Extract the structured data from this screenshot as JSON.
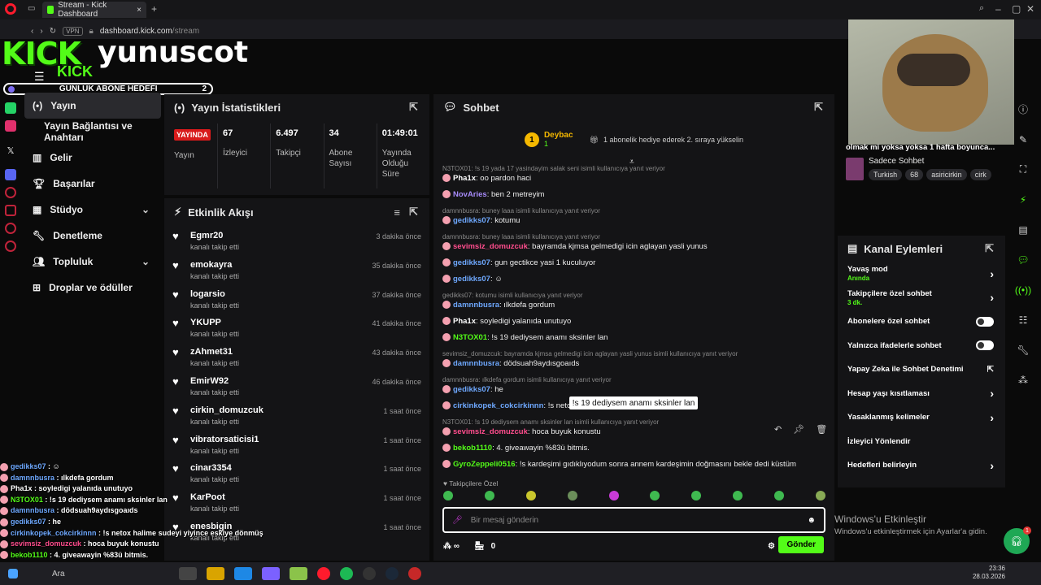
{
  "browser": {
    "tab_title": "Stream - Kick Dashboard",
    "vpn": "VPN",
    "url_host": "dashboard.kick.com",
    "url_path": "/stream"
  },
  "logo": {
    "kick": "KICK",
    "username": "yunuscot",
    "kick_small": "KICK"
  },
  "goal": {
    "label": "GUNLUK ABONE HEDEFI",
    "value": "2"
  },
  "nav": {
    "items": [
      {
        "label": "Yayın",
        "icon": "stream-icon"
      },
      {
        "label": "Yayın Bağlantısı ve Anahtarı",
        "icon": ""
      },
      {
        "label": "Gelir",
        "icon": "revenue-icon"
      },
      {
        "label": "Başarılar",
        "icon": "trophy-icon"
      },
      {
        "label": "Stüdyo",
        "icon": "studio-icon"
      },
      {
        "label": "Denetleme",
        "icon": "wrench-icon"
      },
      {
        "label": "Topluluk",
        "icon": "community-icon"
      },
      {
        "label": "Droplar ve ödüller",
        "icon": "drops-icon"
      }
    ]
  },
  "stats": {
    "title": "Yayın İstatistikleri",
    "live": "YAYINDA",
    "live_label": "Yayın",
    "items": [
      {
        "v": "67",
        "l": "İzleyici"
      },
      {
        "v": "6.497",
        "l": "Takipçi"
      },
      {
        "v": "34",
        "l": "Abone Sayısı"
      },
      {
        "v": "01:49:01",
        "l": "Yayında Olduğu Süre"
      }
    ]
  },
  "events": {
    "title": "Etkinlik Akışı",
    "items": [
      {
        "u": "Egmr20",
        "s": "kanalı takip etti",
        "t": "3 dakika önce"
      },
      {
        "u": "emokayra",
        "s": "kanalı takip etti",
        "t": "35 dakika önce"
      },
      {
        "u": "logarsio",
        "s": "kanalı takip etti",
        "t": "37 dakika önce"
      },
      {
        "u": "YKUPP",
        "s": "kanalı takip etti",
        "t": "41 dakika önce"
      },
      {
        "u": "zAhmet31",
        "s": "kanalı takip etti",
        "t": "43 dakika önce"
      },
      {
        "u": "EmirW92",
        "s": "kanalı takip etti",
        "t": "46 dakika önce"
      },
      {
        "u": "cirkin_domuzcuk",
        "s": "kanalı takip etti",
        "t": "1 saat önce"
      },
      {
        "u": "vibratorsaticisi1",
        "s": "kanalı takip etti",
        "t": "1 saat önce"
      },
      {
        "u": "cinar3354",
        "s": "kanalı takip etti",
        "t": "1 saat önce"
      },
      {
        "u": "KarPoot",
        "s": "kanalı takip etti",
        "t": "1 saat önce"
      },
      {
        "u": "enesbigin",
        "s": "kanalı takip etti",
        "t": "1 saat önce"
      }
    ]
  },
  "chat": {
    "title": "Sohbet",
    "gift_user": "Deybac",
    "gift_count": "1",
    "gift_text": "1 abonelik hediye ederek 2. sıraya yükselin",
    "messages": [
      {
        "r": "N3TOX01: !s 19 yada 17 yasindayim salak seni isimli kullanıcıya yanıt veriyor",
        "n": "Pha1x",
        "c": "#ffffff",
        "t": "oo pardon haci"
      },
      {
        "r": "",
        "n": "NovAries",
        "c": "#a78bfa",
        "t": "ben 2 metreyim"
      },
      {
        "r": "damnnbusra: buney laaa isimli kullanıcıya yanıt veriyor",
        "n": "gedikks07",
        "c": "#6ea8fe",
        "t": "kotumu"
      },
      {
        "r": "damnnbusra: buney laaa isimli kullanıcıya yanıt veriyor",
        "n": "sevimsiz_domuzcuk",
        "c": "#ff4d8d",
        "t": "bayramda kjmsa gelmedigi icin aglayan yasli yunus"
      },
      {
        "r": "",
        "n": "gedikks07",
        "c": "#6ea8fe",
        "t": "gun gectikce yasi 1 kuculuyor"
      },
      {
        "r": "",
        "n": "gedikks07",
        "c": "#6ea8fe",
        "t": "☺"
      },
      {
        "r": "gedikks07: kotumu isimli kullanıcıya yanıt veriyor",
        "n": "damnnbusra",
        "c": "#6ea8fe",
        "t": "ılkdefa gordum"
      },
      {
        "r": "",
        "n": "Pha1x",
        "c": "#ffffff",
        "t": "soyledigi yalanıda unutuyo"
      },
      {
        "r": "",
        "n": "N3TOX01",
        "c": "#53fc18",
        "t": "!s 19 dediysem anamı sksinler lan"
      },
      {
        "r": "sevimsiz_domuzcuk: bayramda kjmsa gelmedigi icin aglayan yasli yunus isimli kullanıcıya yanıt veriyor",
        "n": "damnnbusra",
        "c": "#6ea8fe",
        "t": "dödsuah9aydısgoaıds"
      },
      {
        "r": "damnnbusra: ılkdefa gordum isimli kullanıcıya yanıt veriyor",
        "n": "gedikks07",
        "c": "#6ea8fe",
        "t": "he"
      },
      {
        "r": "",
        "n": "cirkinkopek_cokcirkinnn",
        "c": "#6ea8fe",
        "t": "!s netox ha"
      },
      {
        "r": "N3TOX01: !s 19 dediysem anamı sksinler lan isimli kullanıcıya yanıt veriyor",
        "n": "sevimsiz_domuzcuk",
        "c": "#ff4d8d",
        "t": "hoca buyuk konustu"
      },
      {
        "r": "",
        "n": "bekob1110",
        "c": "#53fc18",
        "t": "4. giveawayin %83ü bitmis."
      },
      {
        "r": "",
        "n": "GyroZeppeli0516",
        "c": "#53fc18",
        "t": "!s kardeşimi gıdıklıyodum sonra annem kardeşimin doğmasını bekle dedi küstüm"
      }
    ],
    "tooltip": "!s 19 dediysem anamı sksinler lan",
    "followers_only": "Takipçilere Özel",
    "input_placeholder": "Bir mesaj gönderin",
    "points": "0",
    "send": "Gönder"
  },
  "stream_info": {
    "title": "olmak mi yoksa yoksa 1 hafta boyunca...",
    "category": "Sadece Sohbet",
    "tags": [
      "Turkish",
      "68",
      "asiricirkin",
      "cirk"
    ]
  },
  "actions": {
    "title": "Kanal Eylemleri",
    "items": [
      {
        "l": "Yavaş mod",
        "s": "Anında",
        "kind": "chev"
      },
      {
        "l": "Takipçilere özel sohbet",
        "s": "3 dk.",
        "kind": "chev"
      },
      {
        "l": "Abonelere özel sohbet",
        "s": "",
        "kind": "toggle"
      },
      {
        "l": "Yalnızca ifadelerle sohbet",
        "s": "",
        "kind": "toggle"
      },
      {
        "l": "Yapay Zeka ile Sohbet Denetimi",
        "s": "",
        "kind": "ext"
      },
      {
        "l": "Hesap yaşı kısıtlaması",
        "s": "",
        "kind": "chev"
      },
      {
        "l": "Yasaklanmış kelimeler",
        "s": "",
        "kind": "chev"
      },
      {
        "l": "İzleyici Yönlendir",
        "s": "",
        "kind": "none"
      },
      {
        "l": "Hedefleri belirleyin",
        "s": "",
        "kind": "chev"
      }
    ]
  },
  "overlay": [
    {
      "n": "gedikks07",
      "c": "#6ea8fe",
      "t": " : ☺"
    },
    {
      "n": "damnnbusra",
      "c": "#6ea8fe",
      "t": " : ılkdefa gordum"
    },
    {
      "n": "Pha1x",
      "c": "#ffffff",
      "t": " : soyledigi yalanıda unutuyo"
    },
    {
      "n": "N3TOX01",
      "c": "#53fc18",
      "t": " : !s 19 dediysem anamı sksinler lan"
    },
    {
      "n": "damnnbusra",
      "c": "#6ea8fe",
      "t": " : dödsuah9aydısgoaıds"
    },
    {
      "n": "gedikks07",
      "c": "#6ea8fe",
      "t": " : he"
    },
    {
      "n": "cirkinkopek_cokcirkinnn",
      "c": "#6ea8fe",
      "t": " : !s netox halime sudeyi yiyince eskiye dönmüş"
    },
    {
      "n": "sevimsiz_domuzcuk",
      "c": "#ff4d8d",
      "t": " : hoca buyuk konustu"
    },
    {
      "n": "bekob1110",
      "c": "#53fc18",
      "t": " : 4. giveawayin %83ü bitmis."
    }
  ],
  "windows": {
    "title": "Windows'u Etkinleştir",
    "sub": "Windows'u etkinleştirmek için Ayarlar'a gidin.",
    "search": "Ara",
    "time": "23:36",
    "date": "28.03.2026"
  },
  "colors": {
    "accent": "#53fc18",
    "bg": "#0a0a0a",
    "panel": "#141416",
    "live": "#d81b1b"
  }
}
